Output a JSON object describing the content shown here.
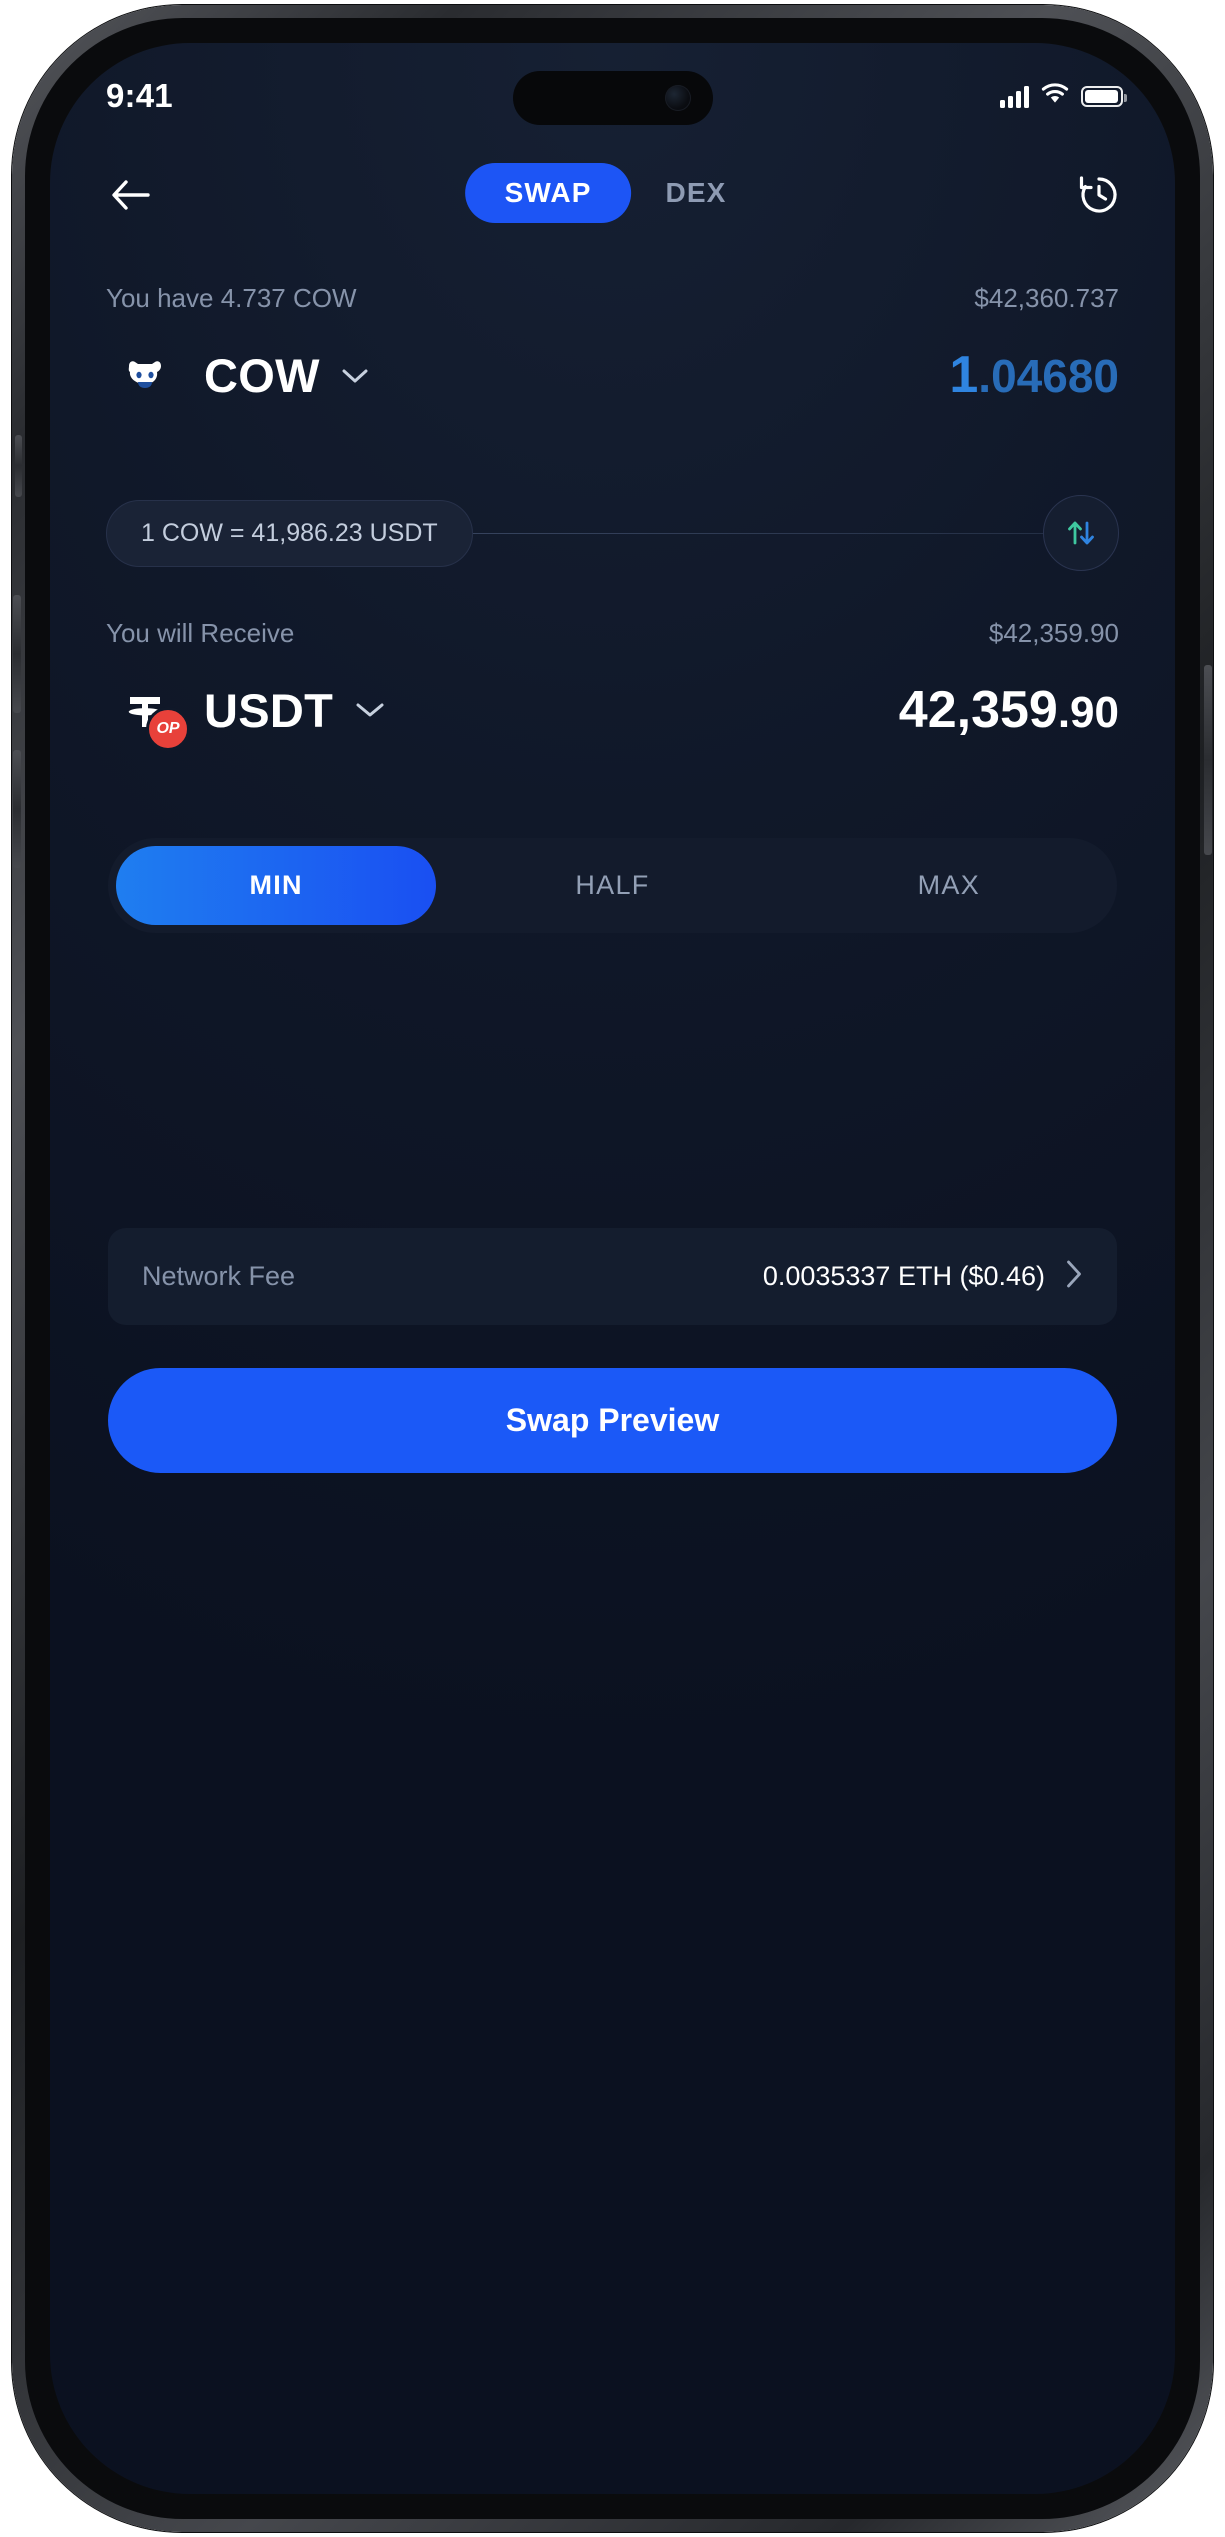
{
  "status_bar": {
    "time": "9:41",
    "signal_icon": "cellular-signal-icon",
    "wifi_icon": "wifi-icon",
    "battery_icon": "battery-icon"
  },
  "header": {
    "back_icon": "back-arrow-icon",
    "history_icon": "history-clock-icon",
    "tabs": [
      {
        "label": "SWAP",
        "active": true
      },
      {
        "label": "DEX",
        "active": false
      }
    ]
  },
  "from": {
    "balance_label": "You have 4.737 COW",
    "fiat_value": "$42,360.737",
    "token_symbol": "COW",
    "token_logo": "cow-token-icon",
    "chevron_icon": "chevron-down-icon",
    "amount_int": "1",
    "amount_dec": ".04680"
  },
  "rate": {
    "text": "1 COW = 41,986.23 USDT",
    "swap_icon": "swap-direction-icon"
  },
  "to": {
    "label": "You will Receive",
    "fiat_value": "$42,359.90",
    "token_symbol": "USDT",
    "token_logo": "tether-token-icon",
    "network_badge": "OP",
    "chevron_icon": "chevron-down-icon",
    "amount_int": "42,359",
    "amount_dec": ".90"
  },
  "presets": [
    {
      "label": "MIN",
      "active": true
    },
    {
      "label": "HALF",
      "active": false
    },
    {
      "label": "MAX",
      "active": false
    }
  ],
  "network_fee": {
    "label": "Network Fee",
    "value": "0.0035337 ETH ($0.46)",
    "chevron_icon": "chevron-right-icon"
  },
  "cta": {
    "label": "Swap Preview"
  },
  "colors": {
    "accent_blue": "#1d55f5",
    "amount_blue": "#2f84e0",
    "usdt_green": "#27b46f",
    "op_red": "#e8413a",
    "screen_bg": "#101829",
    "muted_text": "#8693aa"
  }
}
